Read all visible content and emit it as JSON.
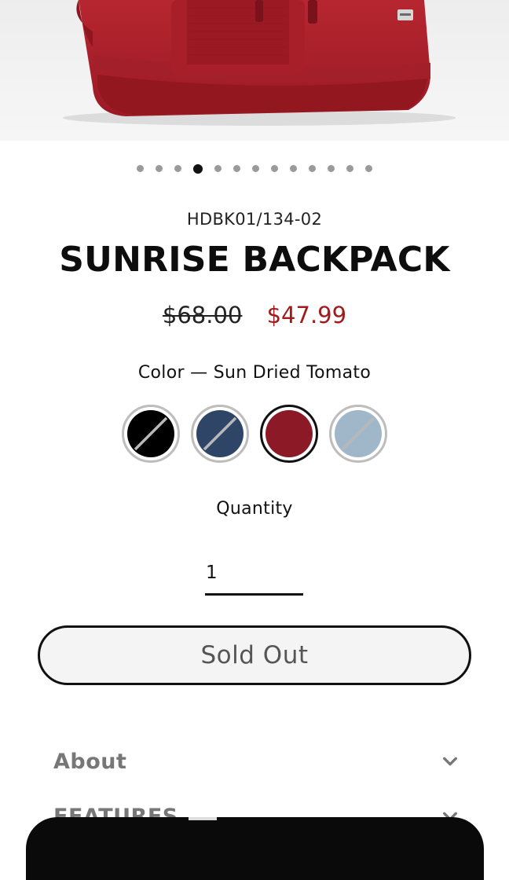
{
  "gallery": {
    "slide_count": 13,
    "active_index": 3
  },
  "product": {
    "sku": "HDBK01/134-02",
    "title": "SUNRISE BACKPACK",
    "price_original": "$68.00",
    "price_sale": "$47.99"
  },
  "color": {
    "label": "Color — Sun Dried Tomato",
    "swatches": [
      {
        "name": "black",
        "hex": "#000000",
        "selected": false,
        "unavailable": true
      },
      {
        "name": "navy",
        "hex": "#2f4567",
        "selected": false,
        "unavailable": true
      },
      {
        "name": "sun-dried-tomato",
        "hex": "#8b1a26",
        "selected": true,
        "unavailable": false
      },
      {
        "name": "light-blue",
        "hex": "#9fb7c9",
        "selected": false,
        "unavailable": true
      }
    ]
  },
  "quantity": {
    "label": "Quantity",
    "value": "1"
  },
  "cta": {
    "label": "Sold Out"
  },
  "accordion": [
    {
      "label": "About",
      "icon": "chevron-down-icon"
    },
    {
      "label": "FEATURES",
      "icon": "chevron-down-icon"
    }
  ],
  "colors": {
    "sale": "#a11b1b",
    "product_red": "#c42a33",
    "bottom_bar": "#0a0a0a"
  }
}
